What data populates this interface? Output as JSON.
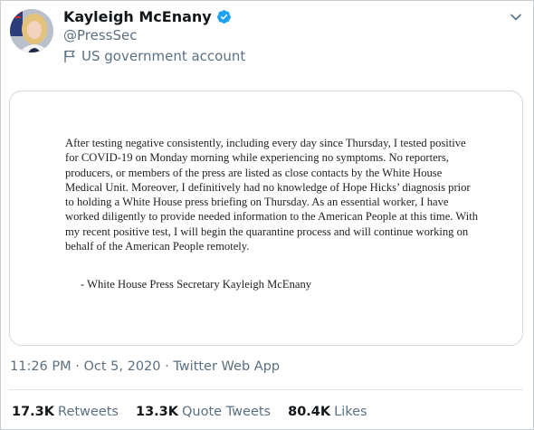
{
  "tweet": {
    "author": {
      "display_name": "Kayleigh McEnany",
      "handle": "@PressSec",
      "label": "US government account",
      "avatar_icon": "profile-photo",
      "verified_icon": "verified-badge-icon",
      "verified_color": "#1da1f2"
    },
    "media": {
      "statement": "After testing negative consistently, including every day since Thursday, I tested positive for COVID-19 on Monday morning while experiencing no symptoms.  No reporters, producers, or members of the press are listed as close contacts by the White House Medical Unit. Moreover, I definitively had no knowledge of Hope Hicks’ diagnosis prior to holding a White House press briefing on Thursday. As an essential worker, I have worked diligently to provide needed information to the American People at this time. With my recent positive test, I will begin the quarantine process and will continue working on behalf of the American People remotely.",
      "signature": "-      White House Press Secretary Kayleigh McEnany"
    },
    "meta": {
      "time": "11:26 PM",
      "date": "Oct 5, 2020",
      "source": "Twitter Web App",
      "separator": "·"
    },
    "stats": {
      "retweets": {
        "count": "17.3K",
        "label": "Retweets"
      },
      "quote_tweets": {
        "count": "13.3K",
        "label": "Quote Tweets"
      },
      "likes": {
        "count": "80.4K",
        "label": "Likes"
      }
    }
  }
}
